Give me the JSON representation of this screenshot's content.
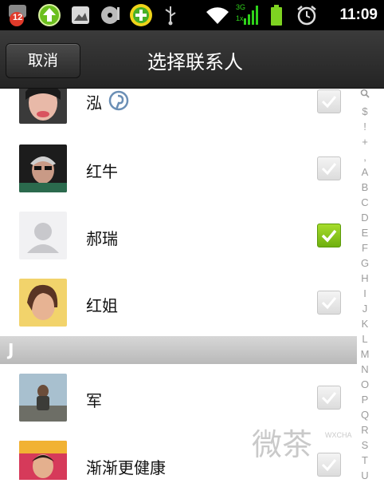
{
  "status_bar": {
    "notification_count": "12",
    "time": "11:09",
    "network": "3G",
    "network_sub": "1x"
  },
  "header": {
    "cancel_label": "取消",
    "title": "选择联系人"
  },
  "contacts": [
    {
      "name": "泓",
      "checked": false,
      "avatar": "avatar-photo"
    },
    {
      "name": "红牛",
      "checked": false,
      "avatar": "avatar-photo"
    },
    {
      "name": "郝瑞",
      "checked": true,
      "avatar": "default-avatar-icon"
    },
    {
      "name": "红姐",
      "checked": false,
      "avatar": "avatar-photo"
    },
    {
      "name": "军",
      "checked": false,
      "avatar": "avatar-photo"
    },
    {
      "name": "渐渐更健康",
      "checked": false,
      "avatar": "avatar-photo"
    }
  ],
  "section_header": "J",
  "index_letters": [
    "$",
    "!",
    "+",
    ",",
    "A",
    "B",
    "C",
    "D",
    "E",
    "F",
    "G",
    "H",
    "I",
    "J",
    "K",
    "L",
    "M",
    "N",
    "O",
    "P",
    "Q",
    "R",
    "S",
    "T",
    "U"
  ],
  "watermark": {
    "text": "微茶",
    "sub": "WXCHA"
  },
  "colors": {
    "accent_checked": "#8cc81e",
    "titlebar": "#2f2f2f",
    "statusbar": "#000000"
  }
}
